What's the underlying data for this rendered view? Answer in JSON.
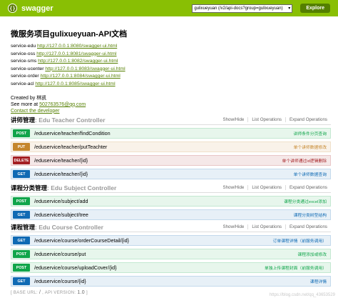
{
  "header": {
    "logo_glyph": "{}",
    "logo_text": "swagger",
    "api_url": "gulixueyuan (/v2/api-docs?group=gulixueyuan)",
    "explore_label": "Explore"
  },
  "info": {
    "title": "微服务项目gulixueyuan-API文档",
    "services": [
      {
        "name": "service-edu",
        "url": "http://127.0.0.1:8080/swagger-ui.html"
      },
      {
        "name": "service-oss",
        "url": "http://127.0.0.1:8081/swagger-ui.html"
      },
      {
        "name": "service-sms",
        "url": "http://127.0.0.1:8082/swagger-ui.html"
      },
      {
        "name": "service-ucenter",
        "url": "http://127.0.0.1:8083/swagger-ui.html"
      },
      {
        "name": "service-order",
        "url": "http://127.0.0.1:8084/swagger-ui.html"
      },
      {
        "name": "service-acl",
        "url": "http://127.0.0.1:8085/swagger-ui.html"
      }
    ],
    "created_by": "Created by 林凯",
    "see_more_prefix": "See more at ",
    "see_more_link": "502763576@qq.com",
    "contact": "Contact the developer"
  },
  "resource_links": {
    "show_hide": "Show/Hide",
    "list_ops": "List Operations",
    "expand_ops": "Expand Operations"
  },
  "resources": [
    {
      "name": "讲师管理",
      "sub": ": Edu Teacher Controller",
      "ops": [
        {
          "method": "POST",
          "path": "/eduservice/teacher/findCondition",
          "summary": "讲师条件分页查询"
        },
        {
          "method": "PUT",
          "path": "/eduservice/teacher/putTeachter",
          "summary": "单个讲师数据修改"
        },
        {
          "method": "DELETE",
          "path": "/eduservice/teacher/{id}",
          "summary": "单个讲师通过id逻辑删除"
        },
        {
          "method": "GET",
          "path": "/eduservice/teacher/{id}",
          "summary": "单个讲师数据查询"
        }
      ]
    },
    {
      "name": "课程分类管理",
      "sub": ": Edu Subject Controller",
      "ops": [
        {
          "method": "POST",
          "path": "/eduservice/subject/add",
          "summary": "课程分类通过excel添加"
        },
        {
          "method": "GET",
          "path": "/eduservice/subject/tree",
          "summary": "课程分类树型结构"
        }
      ]
    },
    {
      "name": "课程管理",
      "sub": ": Edu Course Controller",
      "ops": [
        {
          "method": "GET",
          "path": "/eduservice/course/orderCourseDetail/{id}",
          "summary": "订单课程详情（前服务调用）"
        },
        {
          "method": "POST",
          "path": "/eduservice/course/put",
          "summary": "课程添加或修改"
        },
        {
          "method": "POST",
          "path": "/eduservice/course/uploadCover/{id}",
          "summary": "单独上传课程封面（前服务调用）"
        },
        {
          "method": "GET",
          "path": "/eduservice/course/{id}",
          "summary": "课程详情"
        }
      ]
    }
  ],
  "footer": {
    "base_url_label": "[ BASE URL: ",
    "base_url": "/",
    "api_version_label": " , API VERSION: ",
    "api_version": "1.0",
    "close": " ]"
  },
  "watermark": "https://blog.csdn.net/qq_43653529"
}
